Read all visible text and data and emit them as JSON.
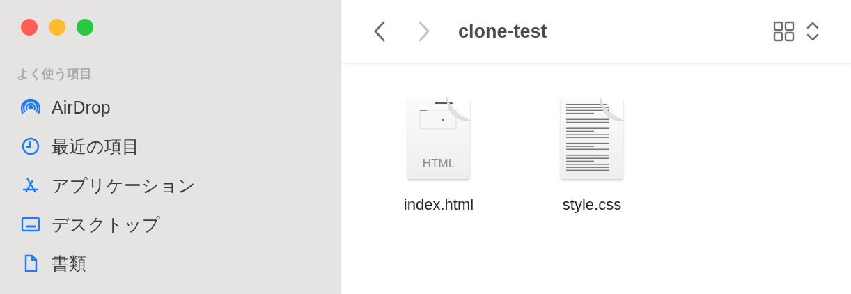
{
  "window": {
    "title": "clone-test"
  },
  "toolbar": {
    "back": {
      "disabled": false
    },
    "forward": {
      "disabled": true
    }
  },
  "sidebar": {
    "section": "よく使う項目",
    "items": [
      {
        "label": "AirDrop",
        "kind": "airdrop"
      },
      {
        "label": "最近の項目",
        "kind": "recent"
      },
      {
        "label": "アプリケーション",
        "kind": "apps"
      },
      {
        "label": "デスクトップ",
        "kind": "desktop"
      },
      {
        "label": "書類",
        "kind": "document"
      }
    ]
  },
  "files": [
    {
      "name": "index.html",
      "kind": "html",
      "badge": "HTML"
    },
    {
      "name": "style.css",
      "kind": "text"
    }
  ]
}
